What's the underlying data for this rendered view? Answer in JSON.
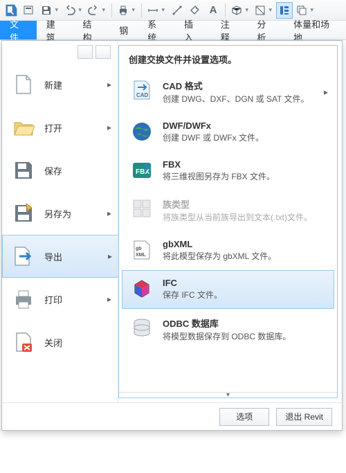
{
  "ribbon": {
    "tabs": [
      "文件",
      "建筑",
      "结构",
      "钢",
      "系统",
      "插入",
      "注释",
      "分析",
      "体量和场地"
    ]
  },
  "fileMenu": {
    "items": [
      {
        "label": "新建",
        "arrow": true
      },
      {
        "label": "打开",
        "arrow": true
      },
      {
        "label": "保存",
        "arrow": false
      },
      {
        "label": "另存为",
        "arrow": true
      },
      {
        "label": "导出",
        "arrow": true,
        "selected": true
      },
      {
        "label": "打印",
        "arrow": true
      },
      {
        "label": "关闭",
        "arrow": false
      }
    ]
  },
  "detail": {
    "title": "创建交换文件并设置选项。",
    "items": [
      {
        "title": "CAD 格式",
        "desc": "创建 DWG、DXF、DGN 或 SAT 文件。",
        "arrow": true
      },
      {
        "title": "DWF/DWFx",
        "desc": "创建 DWF 或 DWFx 文件。"
      },
      {
        "title": "FBX",
        "desc": "将三维视图另存为 FBX 文件。"
      },
      {
        "title": "族类型",
        "desc": "将族类型从当前族导出到文本(.txt)文件。",
        "disabled": true
      },
      {
        "title": "gbXML",
        "desc": "将此模型保存为 gbXML 文件。"
      },
      {
        "title": "IFC",
        "desc": "保存 IFC 文件。",
        "selected": true
      },
      {
        "title": "ODBC 数据库",
        "desc": "将模型数据保存到 ODBC 数据库。"
      }
    ]
  },
  "footer": {
    "options": "选项",
    "exit": "退出 Revit"
  }
}
